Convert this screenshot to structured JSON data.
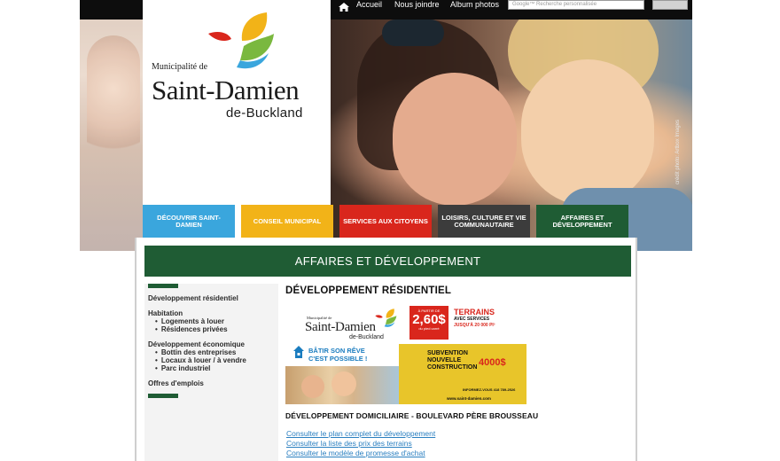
{
  "topbar": {
    "nav": [
      "Accueil",
      "Nous joindre",
      "Album photos"
    ],
    "search_placeholder": "Recherche personnalisée",
    "search_brand": "Google™"
  },
  "logo": {
    "small": "Municipalité de",
    "big": "Saint-Damien",
    "sub": "de-Buckland"
  },
  "photo_credit": "crédit photo: Artbox Images",
  "nav_tiles": [
    {
      "label": "DÉCOUVRIR SAINT-DAMIEN",
      "color": "#3aa6dd"
    },
    {
      "label": "CONSEIL MUNICIPAL",
      "color": "#f2b318"
    },
    {
      "label": "SERVICES AUX CITOYENS",
      "color": "#d9261c"
    },
    {
      "label": "LOISIRS, CULTURE ET VIE COMMUNAUTAIRE",
      "color": "#3c3c3c"
    },
    {
      "label": "AFFAIRES ET DÉVELOPPEMENT",
      "color": "#1f5c34"
    }
  ],
  "section_title": "AFFAIRES ET DÉVELOPPEMENT",
  "sidebar": {
    "item1": "Développement résidentiel",
    "group2": "Habitation",
    "group2_items": [
      "Logements à louer",
      "Résidences privées"
    ],
    "group3": "Développement économique",
    "group3_items": [
      "Bottin des entreprises",
      "Locaux à louer / à vendre",
      "Parc industriel"
    ],
    "item4": "Offres d'emplois"
  },
  "main": {
    "title": "DÉVELOPPEMENT RÉSIDENTIEL",
    "subheading": "DÉVELOPPEMENT DOMICILIAIRE - BOULEVARD PÈRE BROUSSEAU",
    "links": [
      "Consulter le plan complet du développement",
      "Consulter la liste des prix des terrains",
      "Consulter le modèle de promesse d'achat"
    ]
  },
  "promo": {
    "logo_small": "Municipalité de",
    "logo_big": "Saint-Damien",
    "logo_sub": "de-Buckland",
    "price_prefix": "À PARTIR DE",
    "price": "2,60$",
    "price_unit": "du pied carré",
    "terrains": "TERRAINS",
    "services": "AVEC SERVICES",
    "jusqua": "JUSQU'À 20 000 PI²",
    "batir": "BÂTIR SON RÊVE",
    "possible": "C'EST POSSIBLE !",
    "subvention": "SUBVENTION",
    "nouvelle": "NOUVELLE",
    "construction": "CONSTRUCTION",
    "amount": "4000$",
    "info": "INFORMEZ-VOUS 418 789-2526",
    "url": "www.saint-damien.com"
  }
}
